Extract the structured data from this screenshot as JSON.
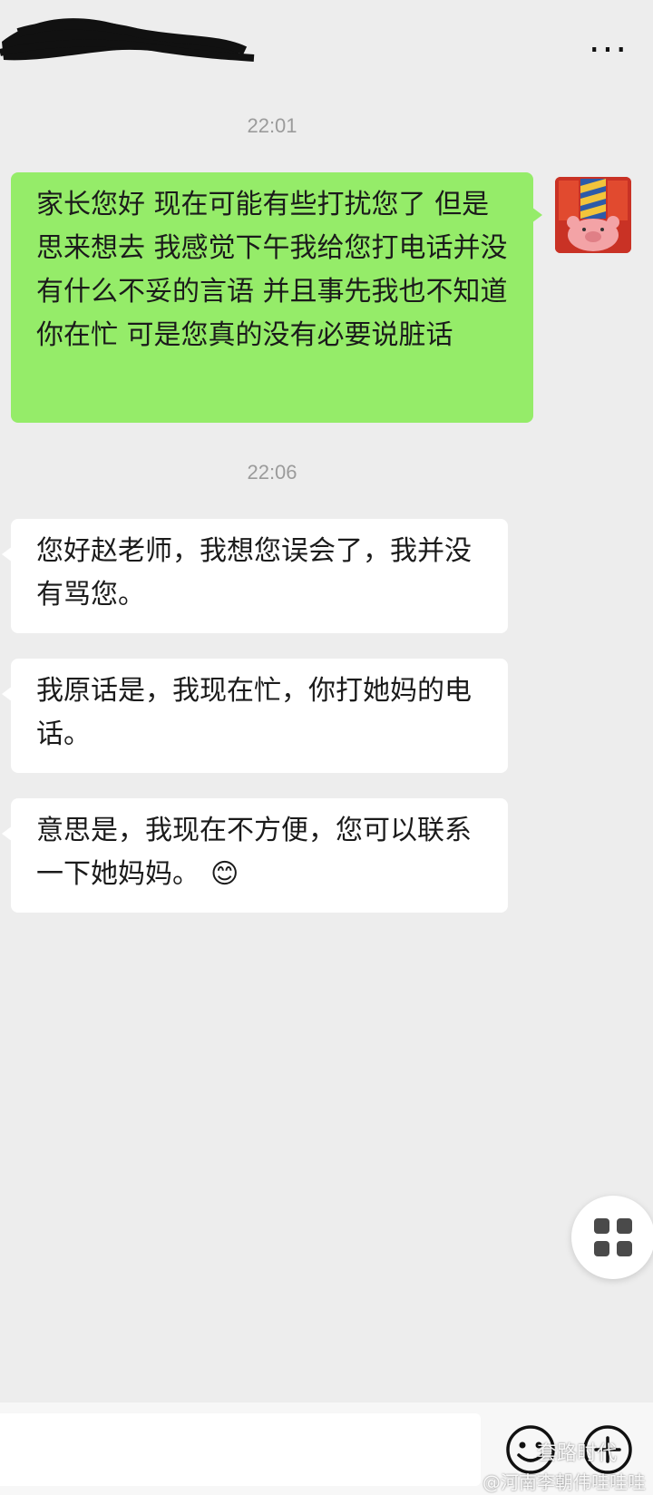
{
  "header": {
    "more_icon": "more-dots-icon",
    "more_label": "..."
  },
  "messages": [
    {
      "type": "time",
      "text": "22:01"
    },
    {
      "type": "sent",
      "text": "家长您好 现在可能有些打扰您了 但是思来想去 我感觉下午我给您打电话并没有什么不妥的言语 并且事先我也不知道你在忙 可是您真的没有必要说脏话"
    },
    {
      "type": "time",
      "text": "22:06"
    },
    {
      "type": "recv",
      "text": "您好赵老师，我想您误会了，我并没有骂您。"
    },
    {
      "type": "recv",
      "text": "我原话是，我现在忙，你打她妈的电话。"
    },
    {
      "type": "recv",
      "text": "意思是，我现在不方便，您可以联系一下她妈妈。",
      "emoji": "😊"
    }
  ],
  "input": {
    "placeholder": ""
  },
  "icons": {
    "emoji_button": "emoji-face-icon",
    "plus_button": "plus-circle-icon",
    "grid_fab": "grid-menu-icon"
  },
  "watermark": {
    "line1": "套路时代",
    "line2": "@河南李朝伟哇哇哇"
  },
  "colors": {
    "background": "#ededed",
    "sent_bubble": "#95ec69",
    "recv_bubble": "#ffffff",
    "timestamp": "#9b9b9b"
  }
}
